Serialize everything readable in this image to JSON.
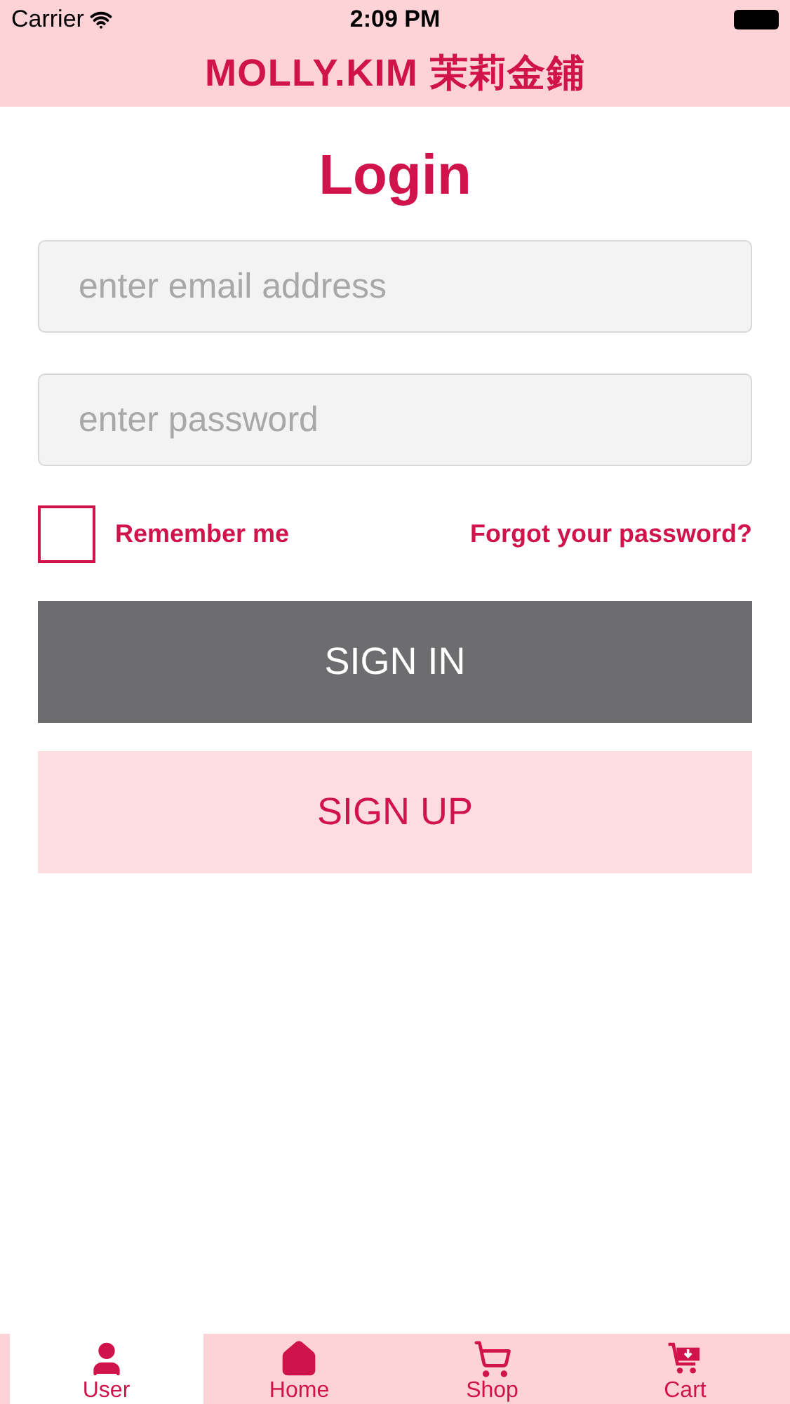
{
  "status_bar": {
    "carrier": "Carrier",
    "time": "2:09 PM"
  },
  "header": {
    "title": "MOLLY.KIM 茉莉金鋪"
  },
  "login": {
    "title": "Login",
    "email": {
      "placeholder": "enter email address"
    },
    "password": {
      "placeholder": "enter password"
    },
    "remember": {
      "label": "Remember me",
      "checked": false
    },
    "forgot": "Forgot your password?",
    "sign_in": "SIGN IN",
    "sign_up": "SIGN UP"
  },
  "tabs": [
    {
      "label": "User",
      "kind": "user",
      "selected": true
    },
    {
      "label": "Home",
      "kind": "home",
      "selected": false
    },
    {
      "label": "Shop",
      "kind": "shop",
      "selected": false
    },
    {
      "label": "Cart",
      "kind": "cart",
      "selected": false
    }
  ]
}
